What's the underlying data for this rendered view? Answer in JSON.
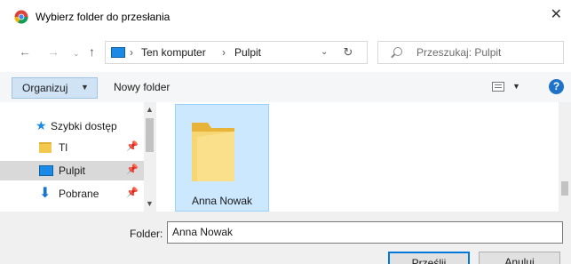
{
  "window": {
    "title": "Wybierz folder do przesłania",
    "close_glyph": "✕",
    "icon": "chrome-icon"
  },
  "nav": {
    "back_glyph": "←",
    "forward_glyph": "→",
    "history_glyph": "⌄",
    "up_glyph": "↑"
  },
  "address": {
    "crumbs": [
      "Ten komputer",
      "Pulpit"
    ],
    "separator": "›",
    "dropdown_glyph": "⌄",
    "refresh_glyph": "↻"
  },
  "search": {
    "placeholder": "Przeszukaj: Pulpit"
  },
  "toolbar": {
    "organize_label": "Organizuj",
    "organize_arrow": "▼",
    "new_folder_label": "Nowy folder",
    "view_arrow": "▼",
    "help_glyph": "?"
  },
  "sidebar": {
    "items": [
      {
        "label": "Szybki dostęp",
        "icon": "star-icon"
      },
      {
        "label": "Tl",
        "icon": "folder-icon",
        "pin": "📌"
      },
      {
        "label": "Pulpit",
        "icon": "desktop-icon",
        "pin": "📌",
        "selected": true
      },
      {
        "label": "Pobrane",
        "icon": "download-icon",
        "pin": "📌"
      }
    ],
    "scroll_up": "▲",
    "scroll_down": "▼"
  },
  "main": {
    "items": [
      {
        "label": "Anna Nowak",
        "icon": "folder-icon",
        "selected": true
      }
    ]
  },
  "bottom": {
    "folder_label": "Folder:",
    "folder_value": "Anna Nowak",
    "upload_button": "Prześlij",
    "cancel_button": "Anuluj"
  },
  "colors": {
    "accent": "#0078d7",
    "selection": "#cce8ff",
    "folder": "#f2c94c"
  }
}
